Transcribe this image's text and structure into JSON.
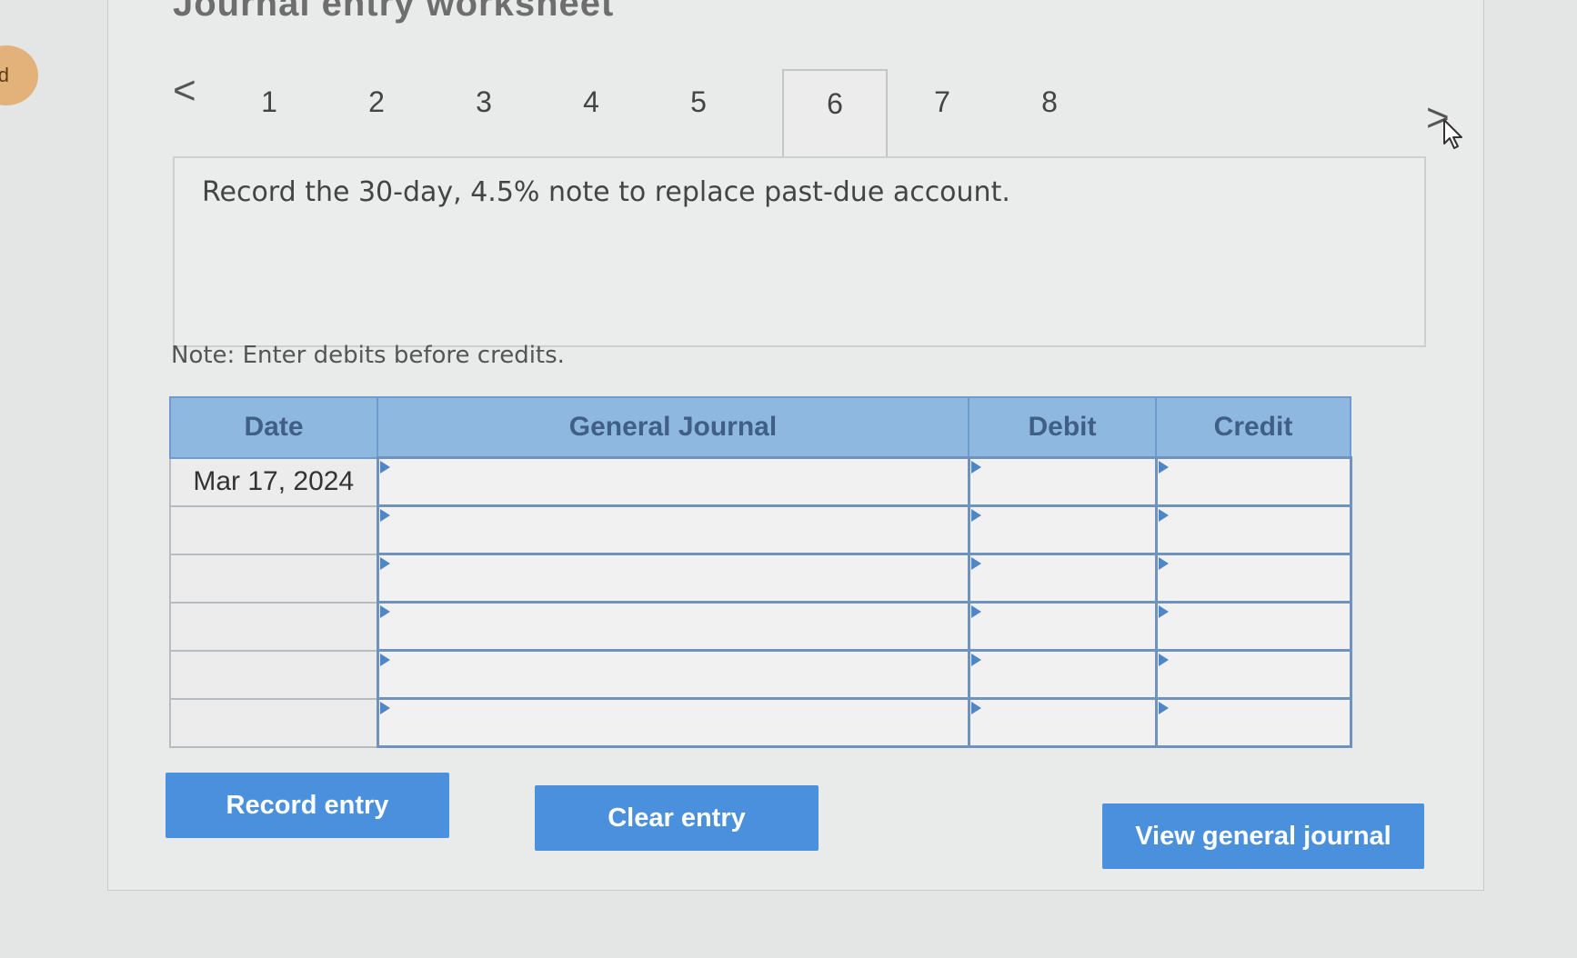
{
  "side_badge": {
    "text": "d"
  },
  "worksheet": {
    "title": "Journal entry worksheet"
  },
  "navigation": {
    "prev_label": "<",
    "next_label": ">",
    "tabs": [
      {
        "label": "1"
      },
      {
        "label": "2"
      },
      {
        "label": "3"
      },
      {
        "label": "4"
      },
      {
        "label": "5"
      },
      {
        "label": "6"
      },
      {
        "label": "7"
      },
      {
        "label": "8"
      }
    ],
    "active_tab": "6"
  },
  "prompt": {
    "text": "Record the 30-day, 4.5% note to replace past-due account."
  },
  "note": {
    "text": "Note: Enter debits before credits."
  },
  "journal_table": {
    "headers": {
      "date": "Date",
      "general_journal": "General Journal",
      "debit": "Debit",
      "credit": "Credit"
    },
    "rows": [
      {
        "date": "Mar 17, 2024",
        "general_journal": "",
        "debit": "",
        "credit": ""
      },
      {
        "date": "",
        "general_journal": "",
        "debit": "",
        "credit": ""
      },
      {
        "date": "",
        "general_journal": "",
        "debit": "",
        "credit": ""
      },
      {
        "date": "",
        "general_journal": "",
        "debit": "",
        "credit": ""
      },
      {
        "date": "",
        "general_journal": "",
        "debit": "",
        "credit": ""
      },
      {
        "date": "",
        "general_journal": "",
        "debit": "",
        "credit": ""
      }
    ]
  },
  "buttons": {
    "record_entry": "Record entry",
    "clear_entry": "Clear entry",
    "view_general_journal": "View general journal"
  },
  "colors": {
    "header_blue": "#8fb8e0",
    "button_blue": "#4a90dc",
    "cell_border_blue": "#6f93bb",
    "marker_blue": "#4f86c6",
    "badge_orange": "#e3b27a"
  },
  "icons": {
    "prev": "chevron-left-icon",
    "next": "chevron-right-icon",
    "row_marker": "triangle-marker-icon",
    "cursor": "mouse-pointer-icon"
  }
}
